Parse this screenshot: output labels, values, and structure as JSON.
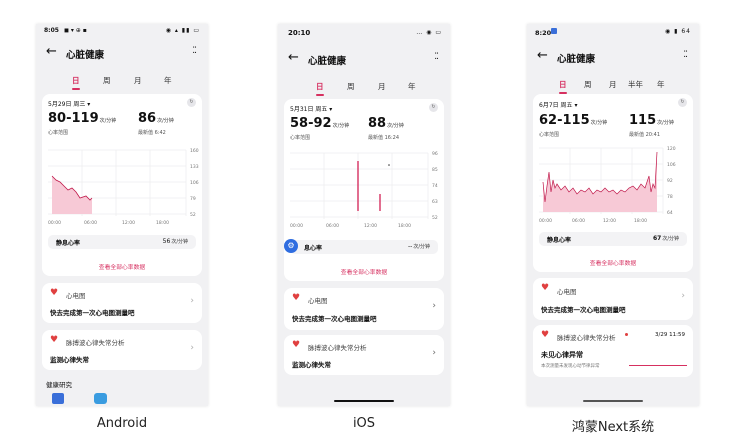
{
  "captions": [
    "Android",
    "iOS",
    "鸿蒙Next系统"
  ],
  "common": {
    "title": "心脏健康",
    "view_all": "查看全部心率数据",
    "ecg_title": "心电图",
    "ecg_body": "快去完成第一次心电图测量吧",
    "arrhythmia_title": "脉搏波心律失常分析",
    "hr_range_label": "心率范围",
    "unit_bpm": "次/分钟",
    "x_ticks": [
      "00:00",
      "06:00",
      "12:00",
      "18:00"
    ]
  },
  "android": {
    "status_time": "8:05",
    "status_icons": "◼ ▾ ⊕ ▪",
    "status_right": "◉ ▴ ▮▮ ▭",
    "tabs": [
      "日",
      "周",
      "月",
      "年"
    ],
    "date": "5月29日 周三 ▾",
    "range": "80-119",
    "latest": "86",
    "latest_label": "最新值 6:42",
    "y_ticks": [
      "160",
      "133",
      "106",
      "79",
      "52"
    ],
    "resting_label": "静息心率",
    "resting_value": "56",
    "arrhythmia_body": "监测心律失常",
    "research": "健康研究"
  },
  "ios": {
    "status_time": "20:10",
    "status_icons": "… ◉ ▭",
    "tabs": [
      "日",
      "周",
      "月",
      "年"
    ],
    "date": "5月31日 周五 ▾",
    "range": "58-92",
    "latest": "88",
    "latest_label": "最新值 16:24",
    "y_ticks": [
      "96",
      "85",
      "74",
      "63",
      "52"
    ],
    "resting_label": "息心率",
    "resting_value": "--",
    "arrhythmia_body": "监测心律失常"
  },
  "harmony": {
    "status_time": "8:20",
    "status_icons": "◉ ▮ 64",
    "tabs": [
      "日",
      "周",
      "月",
      "半年",
      "年"
    ],
    "date": "6月7日 周五 ▾",
    "range": "62-115",
    "latest": "115",
    "latest_label": "最新值 20:41",
    "y_ticks": [
      "120",
      "106",
      "92",
      "78",
      "64"
    ],
    "resting_label": "静息心率",
    "resting_value": "67",
    "arrhythmia_timestamp": "3/29 11:59",
    "arrhythmia_body": "未见心律异常",
    "arrhythmia_note": "本次测量未发现心动节律异常"
  },
  "colors": {
    "accent": "#d63060",
    "chart_fill": "#f7c9d6",
    "line": "#c0184a"
  }
}
